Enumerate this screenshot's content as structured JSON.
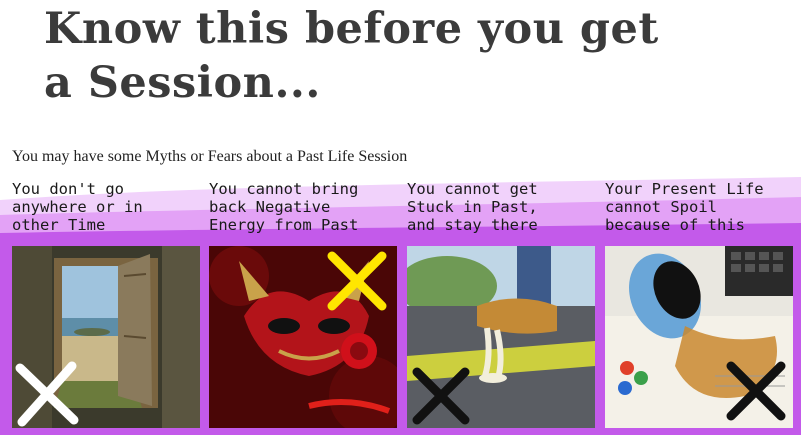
{
  "heading": {
    "title": "Know this before you get a Session..."
  },
  "intro": {
    "text": "You may have some Myths or Fears about a Past Life Session"
  },
  "colors": {
    "band_light": "#f1d2fb",
    "band_mid": "#e3a2f6",
    "band_dark": "#c35aea",
    "title_text": "#3b3b3b"
  },
  "cards": [
    {
      "caption": "You don't go\nanywhere or in\nother Time",
      "image_subject": "open wooden door to seashore",
      "mark_icon": "cross-mark-icon",
      "mark_color": "#ffffff"
    },
    {
      "caption": "You cannot bring\nback Negative\nEnergy from Past",
      "image_subject": "red devil mask with rose",
      "mark_icon": "cross-mark-icon",
      "mark_color": "#ffe600"
    },
    {
      "caption": "You cannot get\nStuck in Past,\nand stay there",
      "image_subject": "shoe stuck in chewing gum on road",
      "mark_icon": "cross-mark-icon",
      "mark_color": "#111111"
    },
    {
      "caption": "Your Present Life\ncannot Spoil\nbecause of this",
      "image_subject": "spilled coffee cup on papers",
      "mark_icon": "cross-mark-icon",
      "mark_color": "#111111"
    }
  ]
}
